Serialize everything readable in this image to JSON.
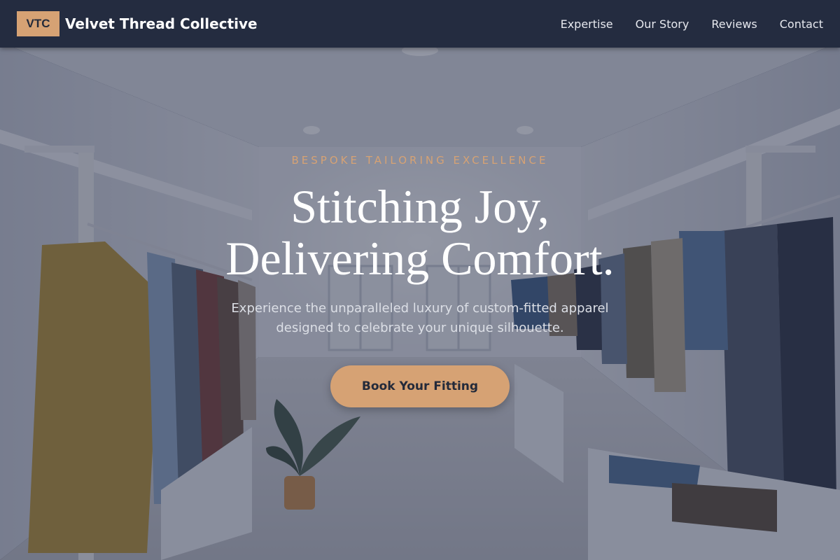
{
  "brand": {
    "badge": "VTC",
    "name": "Velvet Thread Collective"
  },
  "nav": {
    "items": [
      {
        "label": "Expertise"
      },
      {
        "label": "Our Story"
      },
      {
        "label": "Reviews"
      },
      {
        "label": "Contact"
      }
    ]
  },
  "hero": {
    "eyebrow": "BESPOKE TAILORING EXCELLENCE",
    "headline_line1": "Stitching Joy,",
    "headline_line2": "Delivering Comfort.",
    "subtext": "Experience the unparalleled luxury of custom-fitted apparel designed to celebrate your unique silhouette.",
    "cta_label": "Book Your Fitting",
    "background_description_icon": "clothing-store-interior-image"
  },
  "colors": {
    "navbar_bg": "#242c40",
    "accent": "#d6a274",
    "text_light": "#ffffff"
  }
}
